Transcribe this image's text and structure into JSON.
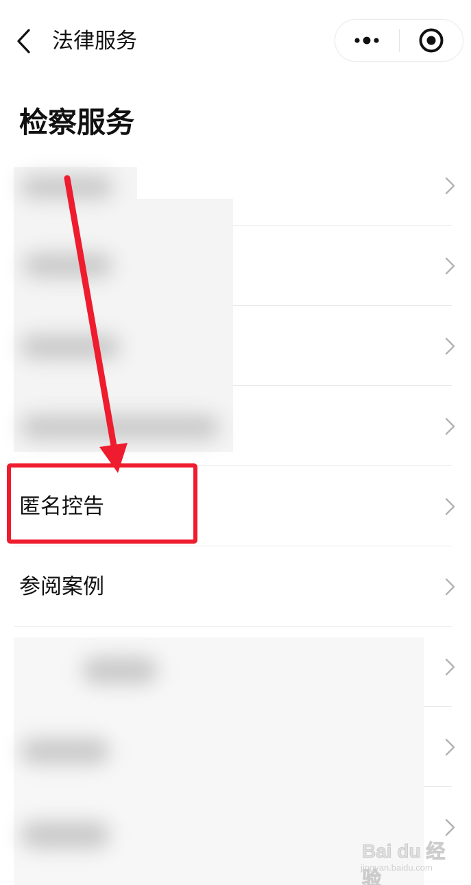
{
  "navbar": {
    "title": "法律服务",
    "back_icon": "chevron-left-icon",
    "more_icon": "more-dots-icon",
    "close_icon": "target-circle-icon"
  },
  "section": {
    "title": "检察服务"
  },
  "list": {
    "items": [
      {
        "label": "",
        "obscured": true
      },
      {
        "label": "",
        "obscured": true
      },
      {
        "label": "",
        "obscured": true
      },
      {
        "label": "",
        "obscured": true
      },
      {
        "label": "匿名控告",
        "obscured": false,
        "highlighted": true
      },
      {
        "label": "参阅案例",
        "obscured": false
      },
      {
        "label": "",
        "obscured": true
      },
      {
        "label": "",
        "obscured": true
      },
      {
        "label": "",
        "obscured": true
      }
    ]
  },
  "annotation": {
    "color": "#ee1c2e"
  },
  "watermark": {
    "logo": "Bai du 经验",
    "sub": "jingyan.baidu.com"
  }
}
